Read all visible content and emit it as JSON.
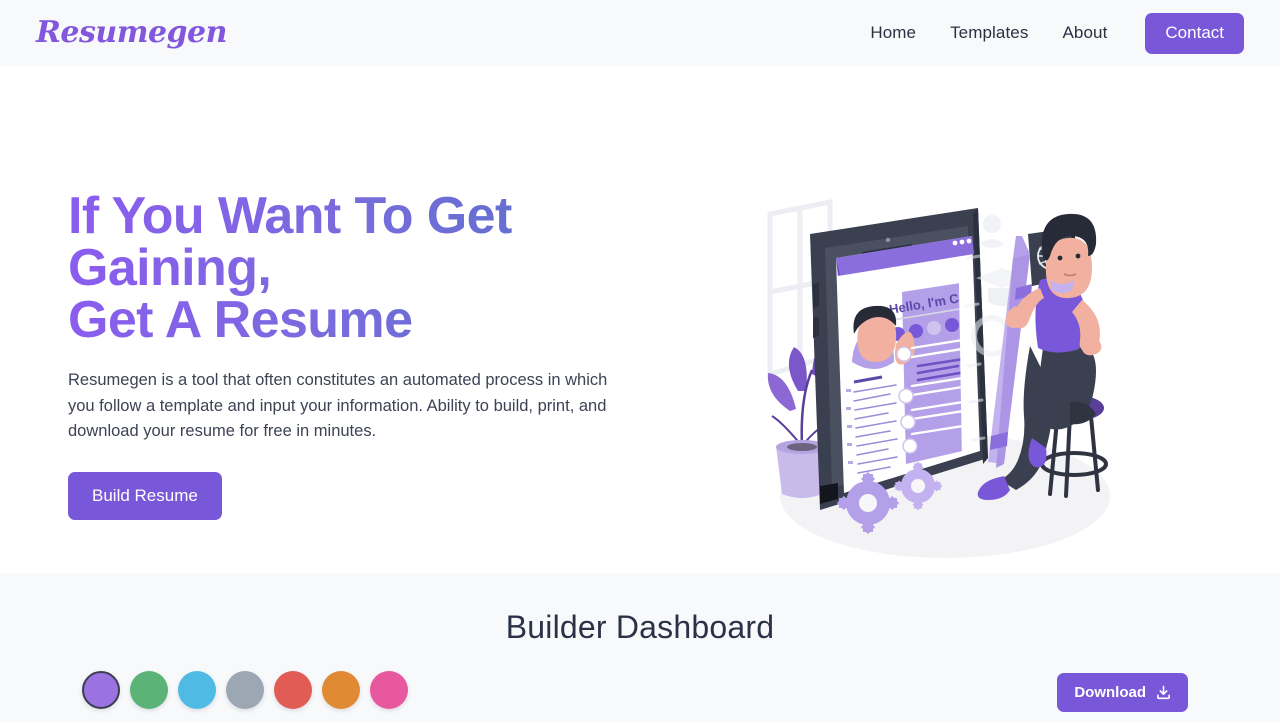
{
  "header": {
    "logo_text": "Resumegen",
    "nav": [
      {
        "label": "Home",
        "name": "nav-link-home"
      },
      {
        "label": "Templates",
        "name": "nav-link-templates"
      },
      {
        "label": "About",
        "name": "nav-link-about"
      }
    ],
    "contact_label": "Contact",
    "background": "#f8f9fb",
    "accent": "#7857d8"
  },
  "hero": {
    "heading": "If You Want To Get Gaining,\nGet A Resume",
    "heading_gradient_from": "#8b5cf0",
    "heading_gradient_to": "#4f74c4",
    "description": "Resumegen is a tool that often constitutes an automated process in which you follow a template and input your information. Ability to build, print, and download your resume for free in minutes.",
    "cta_label": "Build Resume",
    "illustration": {
      "name": "resume-builder-illustration",
      "screen_greeting": "Hello, I'm Carol!",
      "elements": [
        "window-frame",
        "potted-plant",
        "tablet-device",
        "resume-document",
        "avatar-character",
        "social-icons",
        "giant-pencil",
        "woman-on-stool",
        "gears",
        "globe-chat-bubble",
        "graduation-cap"
      ]
    }
  },
  "dashboard": {
    "title": "Builder Dashboard",
    "background": "#f8f9fb",
    "swatches": [
      {
        "name": "color-swatch-purple",
        "color": "#9b72e0",
        "selected": true
      },
      {
        "name": "color-swatch-green",
        "color": "#5cb377",
        "selected": false
      },
      {
        "name": "color-swatch-blue",
        "color": "#4fbbe5",
        "selected": false
      },
      {
        "name": "color-swatch-gray",
        "color": "#9ca7b4",
        "selected": false
      },
      {
        "name": "color-swatch-red",
        "color": "#e05c54",
        "selected": false
      },
      {
        "name": "color-swatch-orange",
        "color": "#e08b33",
        "selected": false
      },
      {
        "name": "color-swatch-pink",
        "color": "#e8589e",
        "selected": false
      }
    ],
    "download_label": "Download",
    "download_icon": "download-icon"
  }
}
